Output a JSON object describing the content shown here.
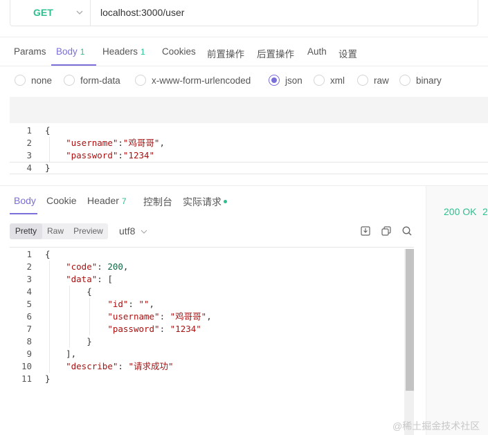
{
  "request": {
    "method": "GET",
    "url": "localhost:3000/user",
    "tabs": [
      {
        "label": "Params",
        "count": ""
      },
      {
        "label": "Body",
        "count": "1"
      },
      {
        "label": "Headers",
        "count": "1"
      },
      {
        "label": "Cookies",
        "count": ""
      },
      {
        "label": "前置操作",
        "count": ""
      },
      {
        "label": "后置操作",
        "count": ""
      },
      {
        "label": "Auth",
        "count": ""
      },
      {
        "label": "设置",
        "count": ""
      }
    ],
    "active_tab": "Body",
    "body_types": [
      "none",
      "form-data",
      "x-www-form-urlencoded",
      "json",
      "xml",
      "raw",
      "binary"
    ],
    "selected_body_type": "json",
    "body_lines": [
      "1",
      "2",
      "3",
      "4"
    ],
    "body_code": {
      "l1": "{",
      "l2_key": "\"username\"",
      "l2_val": "\"鸡哥哥\"",
      "l3_key": "\"password\"",
      "l3_val": "\"1234\"",
      "l4": "}"
    }
  },
  "response": {
    "tabs": [
      {
        "label": "Body",
        "count": ""
      },
      {
        "label": "Cookie",
        "count": ""
      },
      {
        "label": "Header",
        "count": "7"
      },
      {
        "label": "控制台",
        "count": ""
      },
      {
        "label": "实际请求",
        "count": ""
      }
    ],
    "active_tab": "Body",
    "view_modes": [
      "Pretty",
      "Raw",
      "Preview"
    ],
    "active_view_mode": "Pretty",
    "encoding": "utf8",
    "status": "200 OK",
    "status_extra": "2",
    "line_numbers": [
      "1",
      "2",
      "3",
      "4",
      "5",
      "6",
      "7",
      "8",
      "9",
      "10",
      "11"
    ],
    "code": {
      "code_key": "\"code\"",
      "code_val": "200",
      "data_key": "\"data\"",
      "id_key": "\"id\"",
      "id_val": "\"\"",
      "username_key": "\"username\"",
      "username_val": "\"鸡哥哥\"",
      "password_key": "\"password\"",
      "password_val": "\"1234\"",
      "describe_key": "\"describe\"",
      "describe_val": "\"请求成功\""
    }
  },
  "watermark": "@稀土掘金技术社区",
  "colors": {
    "accent": "#7a6fd8",
    "green": "#2fbf8f"
  }
}
